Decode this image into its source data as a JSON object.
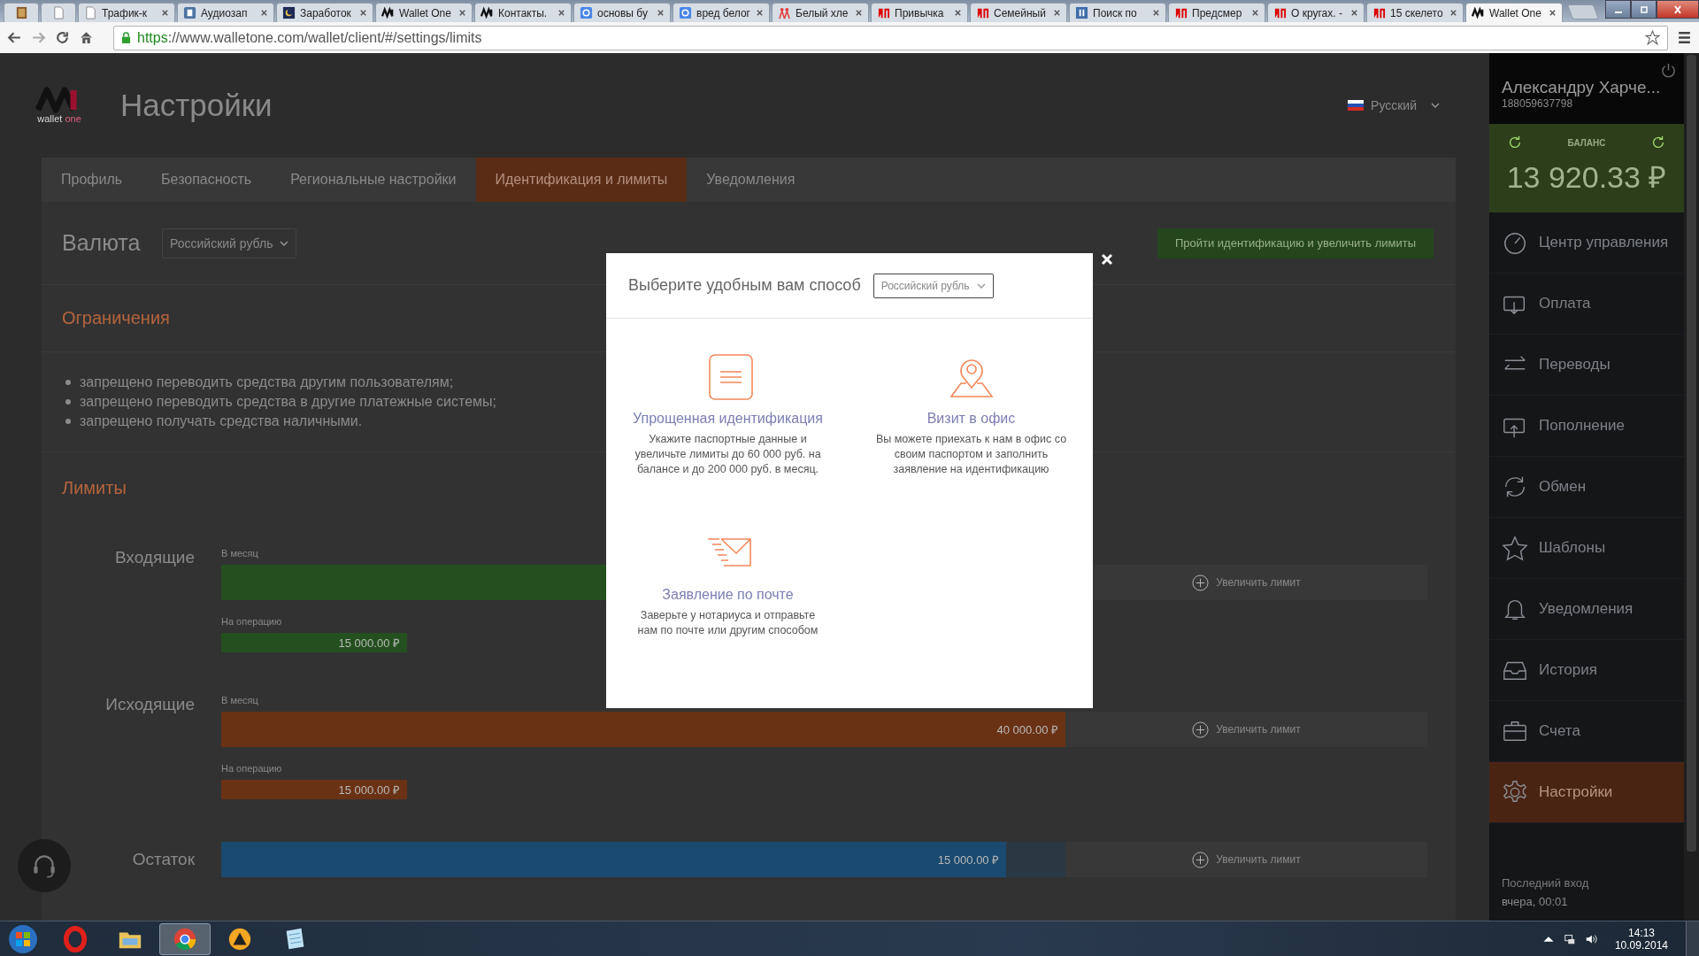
{
  "browser": {
    "tabs": [
      {
        "kind": "book",
        "selected": false
      },
      {
        "kind": "page",
        "selected": false
      },
      {
        "kind": "page",
        "title": "Трафик-к",
        "selected": false
      },
      {
        "kind": "vk",
        "title": "Аудиозап",
        "selected": false
      },
      {
        "kind": "moon",
        "title": "Заработок",
        "selected": false
      },
      {
        "kind": "w1",
        "title": "Wallet One",
        "selected": false
      },
      {
        "kind": "w1",
        "title": "Контакты.",
        "selected": false
      },
      {
        "kind": "google",
        "title": "основы бу",
        "selected": false
      },
      {
        "kind": "google",
        "title": "вред белог",
        "selected": false
      },
      {
        "kind": "people",
        "title": "Белый хле",
        "selected": false
      },
      {
        "kind": "yandex",
        "title": "Привычка",
        "selected": false
      },
      {
        "kind": "yandex",
        "title": "Семейный",
        "selected": false
      },
      {
        "kind": "pause",
        "title": "Поиск по",
        "selected": false
      },
      {
        "kind": "yandex",
        "title": "Предсмер",
        "selected": false
      },
      {
        "kind": "yandex",
        "title": "О кругах. -",
        "selected": false
      },
      {
        "kind": "yandex",
        "title": "15 скелето",
        "selected": false
      },
      {
        "kind": "w1",
        "title": "Wallet One",
        "selected": true
      }
    ],
    "url_scheme": "https",
    "url_rest": "://www.walletone.com/wallet/client/#/settings/limits"
  },
  "header": {
    "logo_word": "wallet",
    "logo_accent": "one",
    "title": "Настройки",
    "language": "Русский"
  },
  "settings_tabs": [
    {
      "label": "Профиль",
      "selected": false
    },
    {
      "label": "Безопасность",
      "selected": false
    },
    {
      "label": "Региональные настройки",
      "selected": false
    },
    {
      "label": "Идентификация и лимиты",
      "selected": true
    },
    {
      "label": "Уведомления",
      "selected": false
    }
  ],
  "currency": {
    "label": "Валюта",
    "value": "Российский рубль",
    "button": "Пройти идентификацию и увеличить лимиты"
  },
  "restrictions": {
    "title": "Ограничения",
    "items": [
      "запрещено переводить средства другим пользователям;",
      "запрещено переводить средства в другие платежные системы;",
      "запрещено получать средства наличными."
    ]
  },
  "limits": {
    "title": "Лимиты",
    "groups": [
      {
        "label": "Входящие",
        "color": "#24501f",
        "rows": [
          {
            "kind": "bar",
            "label": "В месяц",
            "level": 1,
            "action": "Увеличить лимит"
          },
          {
            "kind": "block",
            "label": "На операцию",
            "amount": "15 000.00 ₽"
          }
        ]
      },
      {
        "label": "Исходящие",
        "color": "#6a3214",
        "rows": [
          {
            "kind": "bar",
            "label": "В месяц",
            "level": 1,
            "amount": "40 000.00 ₽",
            "action": "Увеличить лимит"
          },
          {
            "kind": "block",
            "label": "На операцию",
            "amount": "15 000.00 ₽"
          }
        ]
      },
      {
        "label": "Остаток",
        "color": "#1a4a70",
        "rows": [
          {
            "kind": "bar",
            "level": 0.93,
            "amount": "15 000.00 ₽",
            "action": "Увеличить лимит"
          }
        ]
      }
    ]
  },
  "user": {
    "name": "Александру Харче...",
    "account": "188059637798"
  },
  "balance": {
    "label": "БАЛАНС",
    "amount": "13 920.33 ₽"
  },
  "nav": [
    {
      "kind": "gauge",
      "label": "Центр управления",
      "selected": false
    },
    {
      "kind": "wallet-down",
      "label": "Оплата",
      "selected": false
    },
    {
      "kind": "arrows",
      "label": "Переводы",
      "selected": false
    },
    {
      "kind": "wallet-up",
      "label": "Пополнение",
      "selected": false
    },
    {
      "kind": "refresh",
      "label": "Обмен",
      "selected": false
    },
    {
      "kind": "star",
      "label": "Шаблоны",
      "selected": false
    },
    {
      "kind": "bell",
      "label": "Уведомления",
      "selected": false
    },
    {
      "kind": "inbox",
      "label": "История",
      "selected": false
    },
    {
      "kind": "briefcase",
      "label": "Счета",
      "selected": false
    },
    {
      "kind": "gear",
      "label": "Настройки",
      "selected": true
    }
  ],
  "last_login": {
    "label": "Последний вход",
    "value": "вчера, 00:01"
  },
  "modal": {
    "title": "Выберите удобным вам способ",
    "currency": "Российский рубль",
    "options": [
      {
        "kind": "document",
        "title": "Упрощенная идентификация",
        "description": "Укажите паспортные данные и увеличьте лимиты до 60 000 руб. на балансе и до 200 000 руб. в месяц."
      },
      {
        "kind": "pin",
        "title": "Визит в офис",
        "description": "Вы можете приехать к нам в офис со своим паспортом и заполнить заявление на идентификацию"
      },
      {
        "kind": "envelope",
        "title": "Заявление по почте",
        "description": "Заверьте у нотариуса и отправьте нам по почте или другим способом"
      }
    ]
  },
  "taskbar": {
    "apps": [
      {
        "kind": "opera",
        "selected": false
      },
      {
        "kind": "folder",
        "selected": false
      },
      {
        "kind": "chrome",
        "selected": true
      },
      {
        "kind": "aimp",
        "selected": false
      },
      {
        "kind": "notepad",
        "selected": false
      }
    ],
    "time": "14:13",
    "date": "10.09.2014"
  }
}
